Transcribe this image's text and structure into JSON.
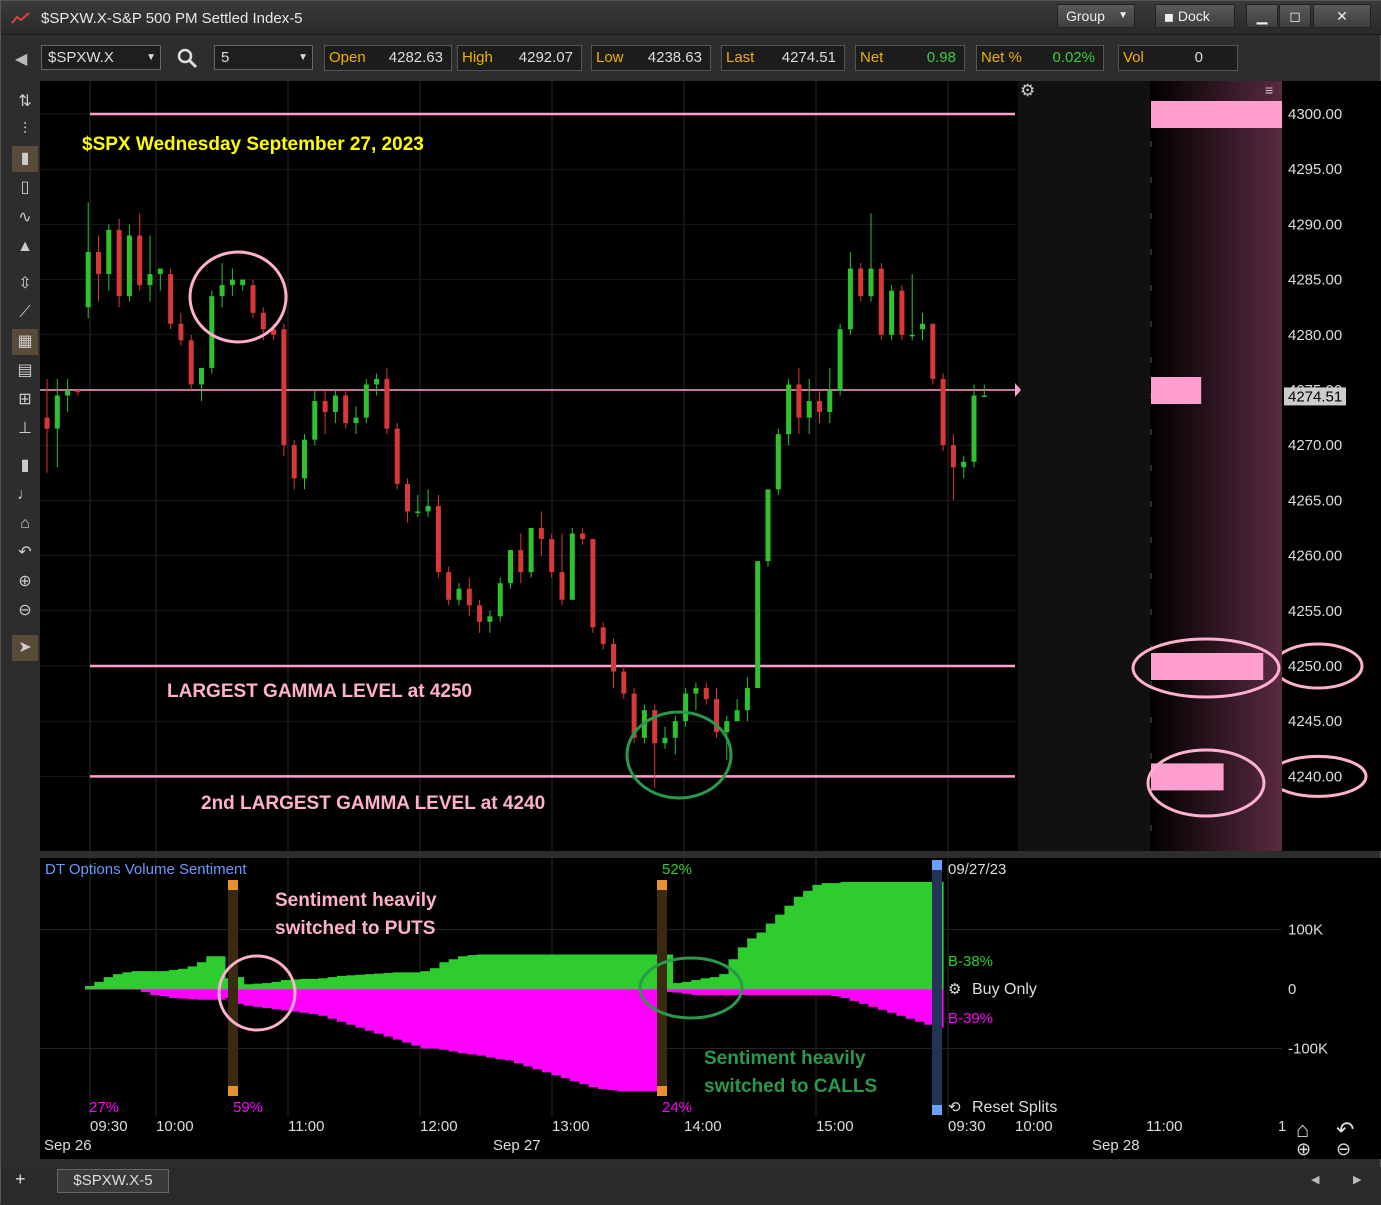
{
  "window": {
    "title": "$SPXW.X-S&P 500 PM Settled Index-5",
    "group": "Group",
    "dock": "Dock"
  },
  "toolbar": {
    "symbol": "$SPXW.X",
    "interval": "5",
    "quote": [
      {
        "label": "Open",
        "value": "4282.63"
      },
      {
        "label": "High",
        "value": "4292.07"
      },
      {
        "label": "Low",
        "value": "4238.63"
      },
      {
        "label": "Last",
        "value": "4274.51"
      },
      {
        "label": "Net",
        "value": "0.98"
      },
      {
        "label": "Net %",
        "value": "0.02%"
      },
      {
        "label": "Vol",
        "value": "0"
      }
    ]
  },
  "colors": {
    "up": "#2ec22e",
    "down": "#d83838",
    "pink": "#ff9fd0",
    "magenta": "#ff00ff",
    "green": "#2ecc2e",
    "annot_green": "#2a9a4a",
    "title_yellow": "#ffff00"
  },
  "chart_data": [
    {
      "type": "candlestick",
      "title": "$SPX Wednesday September 27, 2023",
      "ylim": [
        4234,
        4304
      ],
      "y_ticks": [
        "4300.00",
        "4295.00",
        "4290.00",
        "4285.00",
        "4280.00",
        "4275.00",
        "4270.00",
        "4265.00",
        "4260.00",
        "4255.00",
        "4250.00",
        "4245.00",
        "4240.00"
      ],
      "last_price": "4274.51",
      "horizontal_lines": [
        4300,
        4275,
        4250,
        4240
      ],
      "gamma_bars": [
        {
          "level": 4300,
          "strength": 1.0
        },
        {
          "level": 4275,
          "strength": 0.38
        },
        {
          "level": 4250,
          "strength": 0.85
        },
        {
          "level": 4240,
          "strength": 0.55
        }
      ],
      "annotations": [
        "LARGEST GAMMA LEVEL at 4250",
        "2nd LARGEST GAMMA LEVEL at 4240"
      ],
      "candles": [
        [
          0,
          4272.5,
          4276,
          4267.5,
          4271.5
        ],
        [
          1,
          4271.5,
          4276,
          4268,
          4274.5
        ],
        [
          2,
          4274.5,
          4276,
          4273,
          4275
        ],
        [
          3,
          4275,
          4275,
          4274.5,
          4274.8
        ],
        [
          4,
          4282.5,
          4292,
          4281.5,
          4287.5
        ],
        [
          5,
          4287.5,
          4289,
          4283,
          4285.5
        ],
        [
          6,
          4285.5,
          4290,
          4284,
          4289.5
        ],
        [
          7,
          4289.5,
          4290.5,
          4282.5,
          4283.5
        ],
        [
          8,
          4283.5,
          4290,
          4283,
          4289
        ],
        [
          9,
          4289,
          4291,
          4284,
          4284.5
        ],
        [
          10,
          4284.5,
          4289,
          4283,
          4285.5
        ],
        [
          11,
          4285.5,
          4286,
          4284,
          4286
        ],
        [
          12,
          4285.5,
          4286,
          4280.5,
          4281
        ],
        [
          13,
          4281,
          4282,
          4279,
          4279.5
        ],
        [
          14,
          4279.5,
          4280,
          4275,
          4275.5
        ],
        [
          15,
          4275.5,
          4277,
          4274,
          4277
        ],
        [
          16,
          4277,
          4284,
          4276.5,
          4283.5
        ],
        [
          17,
          4283.5,
          4286.5,
          4282.5,
          4284.5
        ],
        [
          18,
          4284.5,
          4286,
          4283.5,
          4285
        ],
        [
          19,
          4284.5,
          4285,
          4284,
          4285
        ],
        [
          20,
          4284.5,
          4285,
          4281.5,
          4282
        ],
        [
          21,
          4282,
          4282.5,
          4279.5,
          4280.5
        ],
        [
          22,
          4280.5,
          4281,
          4279.5,
          4280
        ],
        [
          23,
          4280.5,
          4281,
          4269,
          4270
        ],
        [
          24,
          4270,
          4270.5,
          4266,
          4267
        ],
        [
          25,
          4267,
          4271,
          4266,
          4270.5
        ],
        [
          26,
          4270.5,
          4275,
          4270,
          4274
        ],
        [
          27,
          4274,
          4275,
          4271,
          4273
        ],
        [
          28,
          4273,
          4275,
          4272,
          4274.5
        ],
        [
          29,
          4274.5,
          4275,
          4271.5,
          4272
        ],
        [
          30,
          4272,
          4273.5,
          4271,
          4272.5
        ],
        [
          31,
          4272.5,
          4276,
          4272,
          4275.5
        ],
        [
          32,
          4275.5,
          4276.5,
          4274.5,
          4276
        ],
        [
          33,
          4276,
          4277,
          4271,
          4271.5
        ],
        [
          34,
          4271.5,
          4272,
          4266,
          4266.5
        ],
        [
          35,
          4266.5,
          4267,
          4263,
          4264
        ],
        [
          36,
          4264,
          4265.5,
          4263.5,
          4264
        ],
        [
          37,
          4264,
          4266,
          4263.5,
          4264.5
        ],
        [
          38,
          4264.5,
          4265.5,
          4258,
          4258.5
        ],
        [
          39,
          4258.5,
          4259,
          4255.5,
          4256
        ],
        [
          40,
          4256,
          4257.5,
          4255.5,
          4257
        ],
        [
          41,
          4257,
          4258,
          4254.5,
          4255.5
        ],
        [
          42,
          4255.5,
          4256,
          4253,
          4254
        ],
        [
          43,
          4254,
          4255,
          4253,
          4254.5
        ],
        [
          44,
          4254.5,
          4258,
          4254,
          4257.5
        ],
        [
          45,
          4257.5,
          4260.5,
          4257,
          4260.5
        ],
        [
          46,
          4260.5,
          4262,
          4257.5,
          4258.5
        ],
        [
          47,
          4258.5,
          4262.5,
          4258,
          4262.5
        ],
        [
          48,
          4262.5,
          4264,
          4260,
          4261.5
        ],
        [
          49,
          4261.5,
          4262,
          4258,
          4258.5
        ],
        [
          50,
          4258.5,
          4262,
          4255.5,
          4256
        ],
        [
          51,
          4256,
          4262.5,
          4256,
          4262
        ],
        [
          52,
          4262,
          4262.5,
          4261,
          4261.5
        ],
        [
          53,
          4261.5,
          4261.5,
          4253,
          4253.5
        ],
        [
          54,
          4253.5,
          4254,
          4251.5,
          4252
        ],
        [
          55,
          4252,
          4252.5,
          4248,
          4249.5
        ],
        [
          56,
          4249.5,
          4250,
          4247,
          4247.5
        ],
        [
          57,
          4247.5,
          4248,
          4243,
          4243.5
        ],
        [
          58,
          4243.5,
          4246.5,
          4243,
          4246
        ],
        [
          59,
          4246,
          4246.5,
          4239,
          4243
        ],
        [
          60,
          4243,
          4244.5,
          4242.5,
          4243.5
        ],
        [
          61,
          4243.5,
          4245.5,
          4242,
          4245
        ],
        [
          62,
          4245,
          4248,
          4244.5,
          4247.5
        ],
        [
          63,
          4247.5,
          4248.5,
          4246,
          4248
        ],
        [
          64,
          4248,
          4248.5,
          4246.5,
          4247
        ],
        [
          65,
          4247,
          4248,
          4243.5,
          4244
        ],
        [
          66,
          4244,
          4245.5,
          4241.5,
          4245
        ],
        [
          67,
          4245,
          4247,
          4245,
          4246
        ],
        [
          68,
          4246,
          4249,
          4245,
          4248
        ],
        [
          69,
          4248,
          4259.5,
          4248,
          4259.5
        ],
        [
          70,
          4259.5,
          4266,
          4259,
          4266
        ],
        [
          71,
          4266,
          4271.5,
          4265.5,
          4271
        ],
        [
          72,
          4271,
          4276,
          4270,
          4275.5
        ],
        [
          73,
          4275.5,
          4277,
          4271,
          4272.5
        ],
        [
          74,
          4272.5,
          4276,
          4271,
          4274
        ],
        [
          75,
          4274,
          4275,
          4272,
          4273
        ],
        [
          76,
          4273,
          4277,
          4272,
          4275
        ],
        [
          77,
          4275,
          4281,
          4274.5,
          4280.5
        ],
        [
          78,
          4280.5,
          4287.5,
          4280,
          4286
        ],
        [
          79,
          4286,
          4286.5,
          4283,
          4283.5
        ],
        [
          80,
          4283.5,
          4291,
          4283,
          4286
        ],
        [
          81,
          4286,
          4286.5,
          4279.5,
          4280
        ],
        [
          82,
          4280,
          4284.5,
          4279.5,
          4284
        ],
        [
          83,
          4284,
          4284.5,
          4279.5,
          4280
        ],
        [
          84,
          4280,
          4285.5,
          4279.5,
          4280
        ],
        [
          85,
          4280.5,
          4282,
          4279.5,
          4281
        ],
        [
          86,
          4281,
          4281,
          4275.5,
          4276
        ],
        [
          87,
          4276,
          4276.5,
          4269.5,
          4270
        ],
        [
          88,
          4270,
          4271,
          4265,
          4268
        ],
        [
          89,
          4268,
          4269,
          4267,
          4268.5
        ],
        [
          90,
          4268.5,
          4275.5,
          4268,
          4274.5
        ],
        [
          91,
          4274.5,
          4275.5,
          4274.5,
          4274.5
        ]
      ]
    },
    {
      "type": "area",
      "title": "DT Options Volume Sentiment",
      "ylim": [
        -180000,
        230000
      ],
      "y_ticks": [
        "100K",
        "0",
        "-100K"
      ],
      "labels": [
        "27%",
        "59%",
        "52%",
        "24%",
        "09/27/23",
        "B-38%",
        "B-39%"
      ],
      "series": [
        {
          "name": "calls",
          "values": [
            5000,
            12000,
            20000,
            25000,
            28000,
            30000,
            30000,
            30000,
            30000,
            32000,
            34000,
            38000,
            45000,
            55000,
            55000,
            18000,
            20000,
            8000,
            9000,
            10000,
            12000,
            15000,
            16000,
            17000,
            17000,
            18000,
            20000,
            22000,
            23000,
            24000,
            25000,
            26000,
            27000,
            28000,
            28000,
            28000,
            30000,
            35000,
            45000,
            50000,
            55000,
            57000,
            58000,
            58000,
            58000,
            58000,
            58000,
            58000,
            58000,
            58000,
            58000,
            58000,
            58000,
            58000,
            58000,
            58000,
            58000,
            58000,
            58000,
            58000,
            58000,
            58000,
            58000,
            10000,
            12000,
            15000,
            18000,
            20000,
            25000,
            50000,
            70000,
            85000,
            95000,
            110000,
            125000,
            140000,
            155000,
            165000,
            175000,
            178000,
            178000,
            180000,
            180000,
            180000,
            180000,
            180000,
            180000,
            180000,
            180000,
            180000,
            180000,
            180000
          ]
        },
        {
          "name": "puts",
          "values": [
            0,
            0,
            0,
            0,
            0,
            0,
            -5000,
            -10000,
            -12000,
            -15000,
            -16000,
            -17000,
            -18000,
            -18000,
            -18000,
            -15000,
            -25000,
            -28000,
            -30000,
            -32000,
            -34000,
            -36000,
            -38000,
            -40000,
            -42000,
            -45000,
            -50000,
            -55000,
            -60000,
            -65000,
            -70000,
            -75000,
            -80000,
            -85000,
            -90000,
            -95000,
            -100000,
            -100000,
            -102000,
            -105000,
            -108000,
            -110000,
            -112000,
            -115000,
            -118000,
            -120000,
            -125000,
            -130000,
            -135000,
            -140000,
            -145000,
            -150000,
            -155000,
            -160000,
            -165000,
            -168000,
            -170000,
            -172000,
            -172000,
            -172000,
            -172000,
            -172000,
            -5000,
            -6000,
            -8000,
            -10000,
            -10000,
            -10000,
            -10000,
            -10000,
            -10000,
            -10000,
            -10000,
            -10000,
            -10000,
            -10000,
            -10000,
            -10000,
            -10000,
            -10000,
            -12000,
            -15000,
            -20000,
            -25000,
            -30000,
            -35000,
            -40000,
            -45000,
            -50000,
            -55000,
            -60000,
            -65000
          ]
        }
      ]
    }
  ],
  "sentiment_annotations": [
    "Sentiment heavily",
    "switched to PUTS",
    "Sentiment heavily",
    "switched to CALLS"
  ],
  "sentiment_controls": {
    "buy_only": "Buy Only",
    "reset_splits": "Reset Splits"
  },
  "time_axis": [
    "Sep 26",
    "09:30",
    "10:00",
    "11:00",
    "12:00",
    "Sep 27",
    "13:00",
    "14:00",
    "15:00",
    "09:30",
    "10:00",
    "Sep 28",
    "11:00",
    "1"
  ],
  "bottom_tab": "$SPXW.X-5"
}
